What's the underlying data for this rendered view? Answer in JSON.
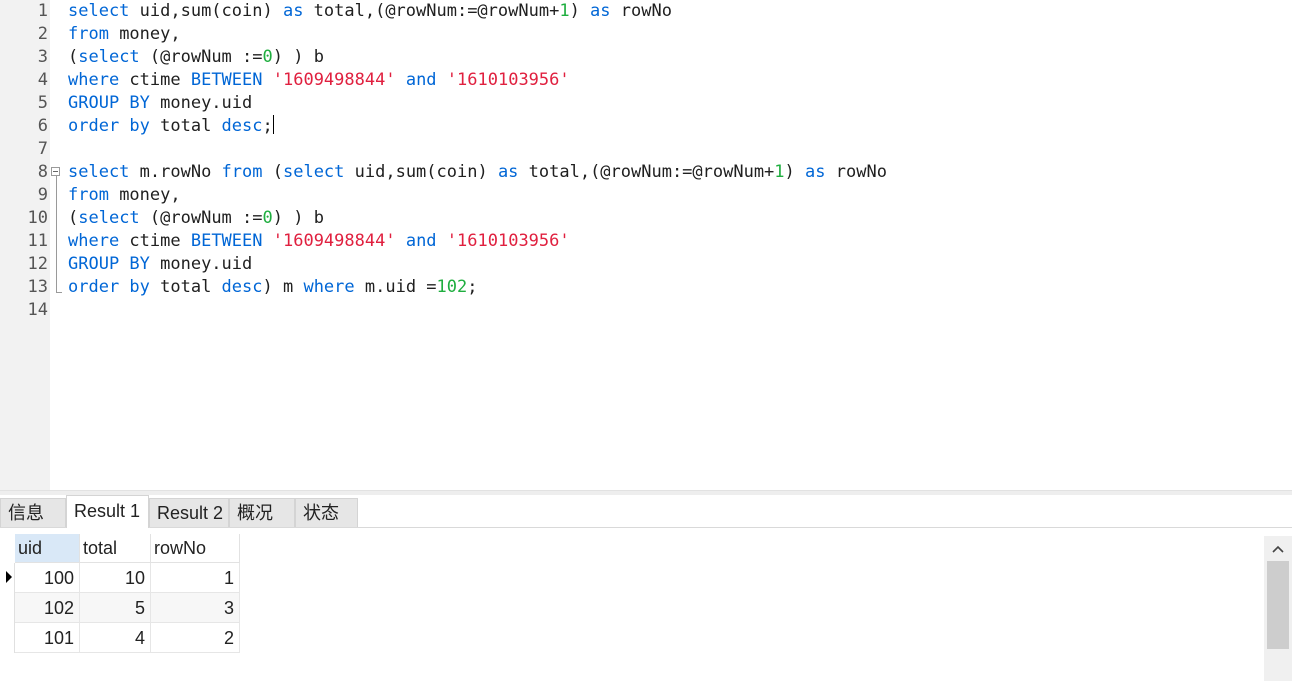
{
  "editor": {
    "line_numbers": [
      "1",
      "2",
      "3",
      "4",
      "5",
      "6",
      "7",
      "8",
      "9",
      "10",
      "11",
      "12",
      "13",
      "14"
    ],
    "lines": [
      [
        {
          "t": "kw",
          "v": "select"
        },
        {
          "t": "pl",
          "v": " uid,sum(coin) "
        },
        {
          "t": "kw",
          "v": "as"
        },
        {
          "t": "pl",
          "v": " total,(@rowNum:=@rowNum+"
        },
        {
          "t": "num",
          "v": "1"
        },
        {
          "t": "pl",
          "v": ") "
        },
        {
          "t": "kw",
          "v": "as"
        },
        {
          "t": "pl",
          "v": " rowNo"
        }
      ],
      [
        {
          "t": "kw",
          "v": "from"
        },
        {
          "t": "pl",
          "v": " money,"
        }
      ],
      [
        {
          "t": "pl",
          "v": "("
        },
        {
          "t": "kw",
          "v": "select"
        },
        {
          "t": "pl",
          "v": " (@rowNum :="
        },
        {
          "t": "num",
          "v": "0"
        },
        {
          "t": "pl",
          "v": ") ) b"
        }
      ],
      [
        {
          "t": "kw",
          "v": "where"
        },
        {
          "t": "pl",
          "v": " ctime "
        },
        {
          "t": "kw",
          "v": "BETWEEN"
        },
        {
          "t": "pl",
          "v": " "
        },
        {
          "t": "str",
          "v": "'1609498844'"
        },
        {
          "t": "pl",
          "v": " "
        },
        {
          "t": "kw",
          "v": "and"
        },
        {
          "t": "pl",
          "v": " "
        },
        {
          "t": "str",
          "v": "'1610103956'"
        }
      ],
      [
        {
          "t": "kw",
          "v": "GROUP BY"
        },
        {
          "t": "pl",
          "v": " money.uid"
        }
      ],
      [
        {
          "t": "kw",
          "v": "order by"
        },
        {
          "t": "pl",
          "v": " total "
        },
        {
          "t": "kw",
          "v": "desc"
        },
        {
          "t": "pl",
          "v": ";"
        }
      ],
      [],
      [
        {
          "t": "kw",
          "v": "select"
        },
        {
          "t": "pl",
          "v": " m.rowNo "
        },
        {
          "t": "kw",
          "v": "from"
        },
        {
          "t": "pl",
          "v": " ("
        },
        {
          "t": "kw",
          "v": "select"
        },
        {
          "t": "pl",
          "v": " uid,sum(coin) "
        },
        {
          "t": "kw",
          "v": "as"
        },
        {
          "t": "pl",
          "v": " total,(@rowNum:=@rowNum+"
        },
        {
          "t": "num",
          "v": "1"
        },
        {
          "t": "pl",
          "v": ") "
        },
        {
          "t": "kw",
          "v": "as"
        },
        {
          "t": "pl",
          "v": " rowNo"
        }
      ],
      [
        {
          "t": "kw",
          "v": "from"
        },
        {
          "t": "pl",
          "v": " money,"
        }
      ],
      [
        {
          "t": "pl",
          "v": "("
        },
        {
          "t": "kw",
          "v": "select"
        },
        {
          "t": "pl",
          "v": " (@rowNum :="
        },
        {
          "t": "num",
          "v": "0"
        },
        {
          "t": "pl",
          "v": ") ) b"
        }
      ],
      [
        {
          "t": "kw",
          "v": "where"
        },
        {
          "t": "pl",
          "v": " ctime "
        },
        {
          "t": "kw",
          "v": "BETWEEN"
        },
        {
          "t": "pl",
          "v": " "
        },
        {
          "t": "str",
          "v": "'1609498844'"
        },
        {
          "t": "pl",
          "v": " "
        },
        {
          "t": "kw",
          "v": "and"
        },
        {
          "t": "pl",
          "v": " "
        },
        {
          "t": "str",
          "v": "'1610103956'"
        }
      ],
      [
        {
          "t": "kw",
          "v": "GROUP BY"
        },
        {
          "t": "pl",
          "v": " money.uid"
        }
      ],
      [
        {
          "t": "kw",
          "v": "order by"
        },
        {
          "t": "pl",
          "v": " total "
        },
        {
          "t": "kw",
          "v": "desc"
        },
        {
          "t": "pl",
          "v": ") m "
        },
        {
          "t": "kw",
          "v": "where"
        },
        {
          "t": "pl",
          "v": " m.uid ="
        },
        {
          "t": "num",
          "v": "102"
        },
        {
          "t": "pl",
          "v": ";"
        }
      ],
      []
    ],
    "colors": {
      "keyword": "#0066d6",
      "string": "#e0203f",
      "number": "#1fae3f",
      "text": "#202020"
    }
  },
  "tabs": [
    {
      "label": "信息",
      "active": false
    },
    {
      "label": "Result 1",
      "active": true
    },
    {
      "label": "Result 2",
      "active": false
    },
    {
      "label": "概况",
      "active": false
    },
    {
      "label": "状态",
      "active": false
    }
  ],
  "grid": {
    "columns": [
      "uid",
      "total",
      "rowNo"
    ],
    "rows": [
      [
        "100",
        "10",
        "1"
      ],
      [
        "102",
        "5",
        "3"
      ],
      [
        "101",
        "4",
        "2"
      ]
    ],
    "current_row": 0
  },
  "icons": {
    "scroll_up": "chevron-up-icon",
    "row_pointer": "row-pointer-icon"
  }
}
